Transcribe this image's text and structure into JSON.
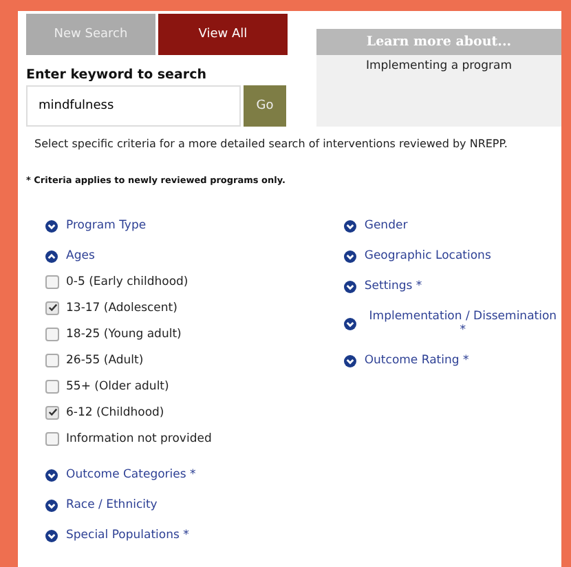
{
  "buttons": [
    {
      "label": "New Search",
      "kind": "neutral"
    },
    {
      "label": "View All",
      "kind": "primary"
    }
  ],
  "learn_more": {
    "title": "Learn more about...",
    "link": "Implementing a program"
  },
  "search": {
    "label": "Enter keyword to search",
    "value": "mindfulness",
    "button": "Go"
  },
  "intro": "Select specific criteria for a more detailed search of interventions reviewed by NREPP.",
  "note": "* Criteria applies to newly reviewed programs only.",
  "filters_left": [
    {
      "label": "Program Type",
      "expanded": false
    },
    {
      "label": "Ages",
      "expanded": true,
      "options": [
        {
          "label": "0-5 (Early childhood)",
          "checked": false
        },
        {
          "label": "13-17 (Adolescent)",
          "checked": true
        },
        {
          "label": "18-25 (Young adult)",
          "checked": false
        },
        {
          "label": "26-55 (Adult)",
          "checked": false
        },
        {
          "label": "55+ (Older adult)",
          "checked": false
        },
        {
          "label": "6-12 (Childhood)",
          "checked": true
        },
        {
          "label": "Information not provided",
          "checked": false
        }
      ]
    },
    {
      "label": "Outcome Categories *",
      "expanded": false
    },
    {
      "label": "Race / Ethnicity",
      "expanded": false
    },
    {
      "label": "Special Populations *",
      "expanded": false
    }
  ],
  "filters_right": [
    {
      "label": "Gender",
      "expanded": false
    },
    {
      "label": "Geographic Locations",
      "expanded": false
    },
    {
      "label": "Settings *",
      "expanded": false
    },
    {
      "label": "Implementation / Dissemination *",
      "expanded": false
    },
    {
      "label": "Outcome Rating *",
      "expanded": false
    }
  ]
}
